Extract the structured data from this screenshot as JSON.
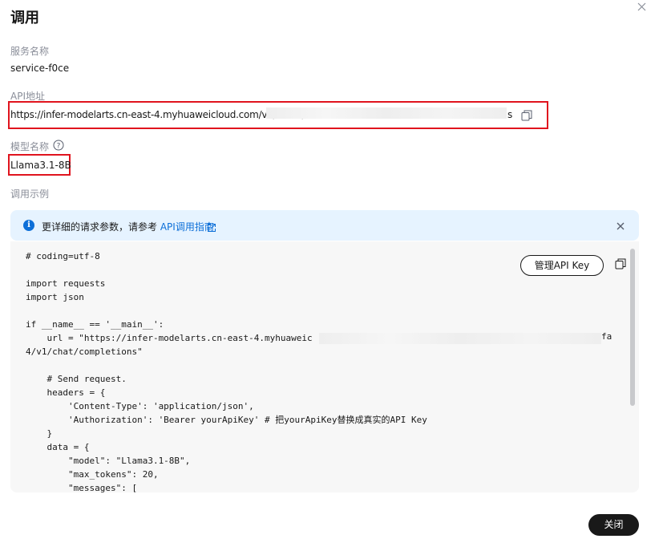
{
  "dialog": {
    "title": "调用",
    "close_label": "关闭"
  },
  "service": {
    "label": "服务名称",
    "value": "service-f0ce"
  },
  "api": {
    "label": "API地址",
    "url_prefix": "https://infer-modelarts.cn-east-4.myhuaweicloud.com/v1/infers/5",
    "url_suffix": "s"
  },
  "model": {
    "label": "模型名称",
    "value": "Llama3.1-8B"
  },
  "example": {
    "label": "调用示例"
  },
  "notice": {
    "text": "更详细的请求参数，请参考 ",
    "link_label": "API调用指南"
  },
  "code": {
    "manage_key_label": "管理API Key",
    "lines": [
      "# coding=utf-8",
      "",
      "import requests",
      "import json",
      "",
      "if __name__ == '__main__':",
      "    url = \"https://infer-modelarts.cn-east-4.myhuaweic",
      "4/v1/chat/completions\"",
      "",
      "    # Send request.",
      "    headers = {",
      "        'Content-Type': 'application/json',",
      "        'Authorization': 'Bearer yourApiKey' # 把yourApiKey替换成真实的API Key",
      "    }",
      "    data = {",
      "        \"model\": \"Llama3.1-8B\",",
      "        \"max_tokens\": 20,",
      "        \"messages\": ["
    ],
    "url_line_tail": "fa"
  },
  "colors": {
    "highlight_border": "#e0141e",
    "link": "#0d6fd8",
    "notice_bg": "#e6f3ff",
    "code_bg": "#f7f7f7",
    "primary_button": "#191919"
  },
  "icons": [
    "close-icon",
    "copy-icon",
    "help-icon",
    "info-icon",
    "external-link-icon"
  ]
}
